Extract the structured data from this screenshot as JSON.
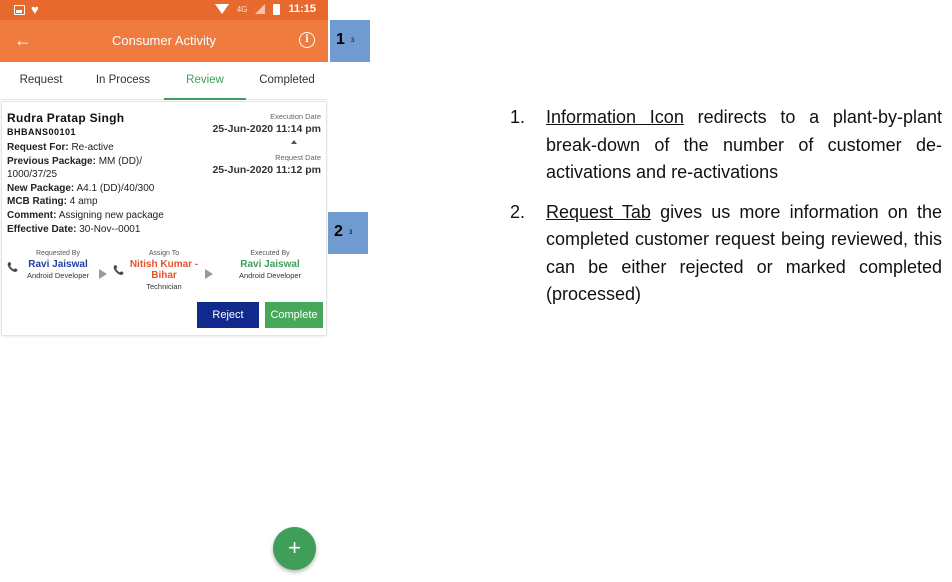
{
  "status_bar": {
    "network": "4G",
    "time": "11:15",
    "icons": [
      "photo-icon",
      "heart-icon",
      "wifi-icon",
      "signal-icon",
      "battery-icon"
    ]
  },
  "app_bar": {
    "title": "Consumer Activity",
    "back_icon": "arrow-left-icon",
    "info_icon": "info-icon",
    "color": "#ef7b3e"
  },
  "tabs": [
    {
      "label": "Request",
      "active": false
    },
    {
      "label": "In Process",
      "active": false
    },
    {
      "label": "Review",
      "active": true
    },
    {
      "label": "Completed",
      "active": false
    }
  ],
  "card": {
    "name": "Rudra Pratap Singh",
    "code": "BHBANS00101",
    "fields": [
      {
        "key": "Request For:",
        "value": "Re-active"
      },
      {
        "key": "Previous Package:",
        "value": "MM (DD)/ 1000/37/25"
      },
      {
        "key": "New Package:",
        "value": "A4.1 (DD)/40/300"
      },
      {
        "key": "MCB Rating:",
        "value": "4 amp"
      },
      {
        "key": "Comment:",
        "value": "Assigning new package"
      },
      {
        "key": "Effective Date:",
        "value": "30-Nov--0001"
      }
    ],
    "execution_date_label": "Execution Date",
    "execution_date": "25-Jun-2020 11:14 pm",
    "request_date_label": "Request Date",
    "request_date": "25-Jun-2020 11:12 pm",
    "requested_by": {
      "label": "Requested By",
      "name": "Ravi Jaiswal",
      "role": "Android Developer",
      "color": "#1f3fa0"
    },
    "assign_to": {
      "label": "Assign To",
      "name": "Nitish Kumar - Bihar",
      "role": "Technician",
      "color": "#e8532a"
    },
    "executed_by": {
      "label": "Executed By",
      "name": "Ravi Jaiswal",
      "role": "Android Developer",
      "color": "#3f9e5a"
    },
    "reject_label": "Reject",
    "complete_label": "Complete"
  },
  "fab": {
    "label": "+"
  },
  "markers": [
    {
      "num": "1",
      "sub": "3"
    },
    {
      "num": "2",
      "sub": "3"
    }
  ],
  "annotations": [
    {
      "num": "1.",
      "term": "Information Icon",
      "text": " redirects to a plant-by-plant break-down of the number of customer de-activations and re-activations"
    },
    {
      "num": "2.",
      "term": "Request Tab",
      "text": " gives us more information on the completed customer request being reviewed, this can be either rejected or marked completed (processed)"
    }
  ]
}
